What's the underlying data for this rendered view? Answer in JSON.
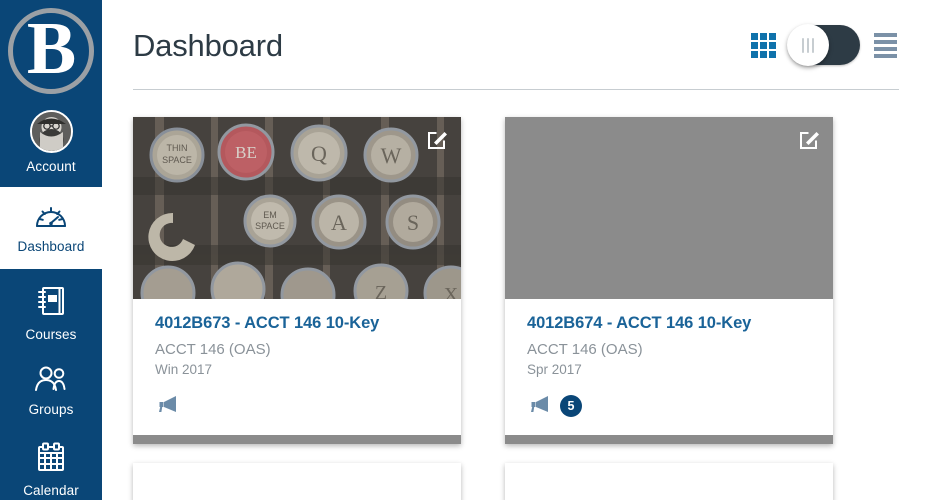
{
  "sidebar": {
    "logo": {
      "letter": "B",
      "name": "institution-logo"
    },
    "items": [
      {
        "id": "account",
        "label": "Account",
        "icon": "user-avatar-icon",
        "active": false
      },
      {
        "id": "dashboard",
        "label": "Dashboard",
        "icon": "speedometer-icon",
        "active": true
      },
      {
        "id": "courses",
        "label": "Courses",
        "icon": "notebook-icon",
        "active": false
      },
      {
        "id": "groups",
        "label": "Groups",
        "icon": "people-icon",
        "active": false
      },
      {
        "id": "calendar",
        "label": "Calendar",
        "icon": "calendar-icon",
        "active": false
      }
    ]
  },
  "header": {
    "title": "Dashboard",
    "grid_icon": "grid-view-icon",
    "toggle": {
      "name": "dashboard-view-toggle",
      "state": "off"
    },
    "list_icon": "list-view-icon"
  },
  "cards": [
    {
      "title": "4012B673 - ACCT 146 10-Key",
      "subtitle": "ACCT 146 (OAS)",
      "term": "Win 2017",
      "image": "typewriter-keys-photo",
      "edit_icon": "edit-pencil-icon",
      "announcement_icon": "announcement-megaphone-icon",
      "badge": null,
      "header_color": "#8b8b8b",
      "footer_color": "#8b8b8b"
    },
    {
      "title": "4012B674 - ACCT 146 10-Key",
      "subtitle": "ACCT 146 (OAS)",
      "term": "Spr 2017",
      "image": "plain-gray-placeholder",
      "edit_icon": "edit-pencil-icon",
      "announcement_icon": "announcement-megaphone-icon",
      "badge": "5",
      "header_color": "#8b8b8b",
      "footer_color": "#8b8b8b"
    }
  ],
  "colors": {
    "sidebar_bg": "#0a4677",
    "accent_blue": "#0f72ab",
    "link_blue": "#1a6398",
    "muted_text": "#8a9299",
    "title_text": "#2d3b45",
    "badge_bg": "#0a4677",
    "card_gray": "#8b8b8b"
  }
}
